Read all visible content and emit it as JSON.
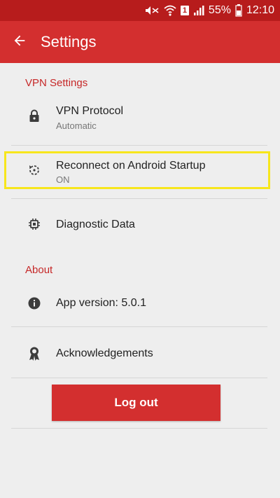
{
  "status_bar": {
    "icons": [
      "mute-icon",
      "wifi-icon",
      "sim-icon",
      "signal-icon",
      "battery-icon"
    ],
    "sim_label": "1",
    "battery": "55%",
    "time": "12:10"
  },
  "app_bar": {
    "title": "Settings",
    "back_icon": "arrow-back-icon"
  },
  "sections": {
    "vpn": {
      "header": "VPN Settings",
      "items": [
        {
          "title": "VPN Protocol",
          "subtitle": "Automatic",
          "icon": "lock-icon"
        },
        {
          "title": "Reconnect on Android Startup",
          "subtitle": "ON",
          "icon": "restore-icon",
          "highlighted": true
        },
        {
          "title": "Diagnostic Data",
          "icon": "chip-icon"
        }
      ]
    },
    "about": {
      "header": "About",
      "items": [
        {
          "title": "App version: 5.0.1",
          "icon": "info-icon"
        },
        {
          "title": "Acknowledgements",
          "icon": "award-icon"
        }
      ]
    }
  },
  "logout_label": "Log out",
  "colors": {
    "status_bar": "#b71c1c",
    "app_bar": "#d32f2f",
    "accent": "#c62828",
    "highlight": "#f7e61c",
    "background": "#eeeeee"
  }
}
